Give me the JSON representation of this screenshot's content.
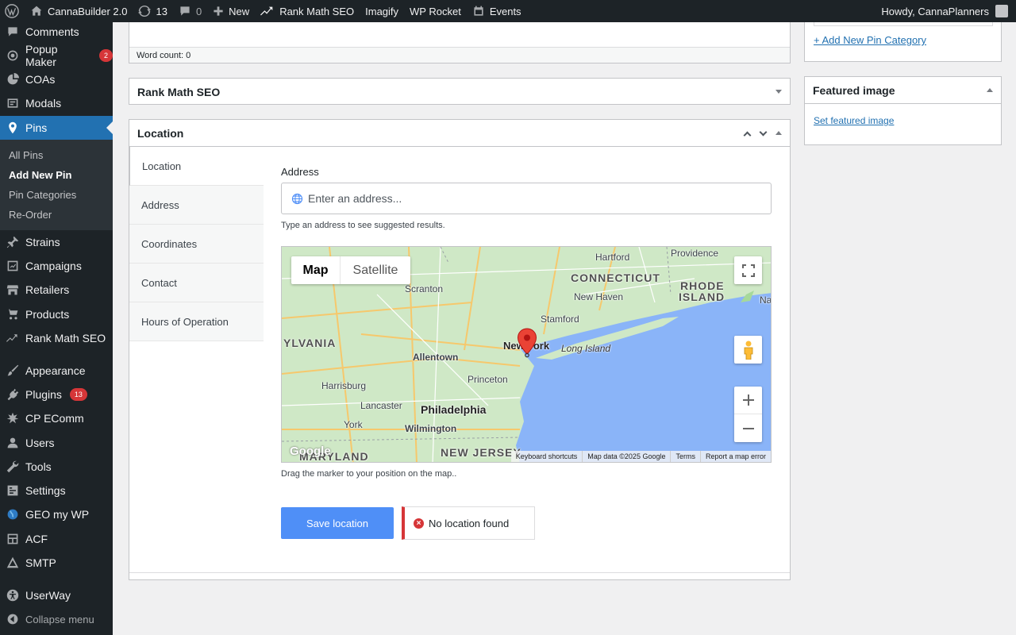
{
  "admin_bar": {
    "site_name": "CannaBuilder 2.0",
    "updates_count": "13",
    "comments_count": "0",
    "new_label": "New",
    "rank_math": "Rank Math SEO",
    "imagify": "Imagify",
    "wp_rocket": "WP Rocket",
    "events": "Events",
    "howdy": "Howdy, CannaPlanners"
  },
  "sidebar": {
    "items": [
      {
        "label": "Comments",
        "icon": "comment-icon"
      },
      {
        "label": "Popup Maker",
        "icon": "popup-icon",
        "badge": "2"
      },
      {
        "label": "COAs",
        "icon": "pie-icon"
      },
      {
        "label": "Modals",
        "icon": "modal-icon"
      },
      {
        "label": "Pins",
        "icon": "location-pin-icon"
      },
      {
        "label": "Strains",
        "icon": "pushpin-icon"
      },
      {
        "label": "Campaigns",
        "icon": "chart-icon"
      },
      {
        "label": "Retailers",
        "icon": "store-icon"
      },
      {
        "label": "Products",
        "icon": "cart-icon"
      },
      {
        "label": "Rank Math SEO",
        "icon": "rankmath-icon"
      },
      {
        "label": "Appearance",
        "icon": "brush-icon"
      },
      {
        "label": "Plugins",
        "icon": "plug-icon",
        "badge": "13"
      },
      {
        "label": "CP EComm",
        "icon": "ecomm-icon"
      },
      {
        "label": "Users",
        "icon": "user-icon"
      },
      {
        "label": "Tools",
        "icon": "wrench-icon"
      },
      {
        "label": "Settings",
        "icon": "settings-icon"
      },
      {
        "label": "GEO my WP",
        "icon": "globe-icon"
      },
      {
        "label": "ACF",
        "icon": "acf-icon"
      },
      {
        "label": "SMTP",
        "icon": "smtp-icon"
      },
      {
        "label": "UserWay",
        "icon": "accessibility-icon"
      },
      {
        "label": "Collapse menu",
        "icon": "collapse-icon"
      }
    ],
    "submenu": [
      "All Pins",
      "Add New Pin",
      "Pin Categories",
      "Re-Order"
    ],
    "current_submenu": "Add New Pin"
  },
  "editor": {
    "word_count": "Word count: 0"
  },
  "rank_math_box": {
    "title": "Rank Math SEO"
  },
  "location_box": {
    "title": "Location",
    "tabs": [
      "Location",
      "Address",
      "Coordinates",
      "Contact",
      "Hours of Operation"
    ],
    "active_tab": "Location",
    "address_label": "Address",
    "address_placeholder": "Enter an address...",
    "address_help": "Type an address to see suggested results.",
    "drag_help": "Drag the marker to your position on the map..",
    "save_button": "Save location",
    "notice": "No location found"
  },
  "map": {
    "type_buttons": [
      "Map",
      "Satellite"
    ],
    "active_type": "Map",
    "labels": {
      "hartford": "Hartford",
      "providence": "Providence",
      "connecticut": "CONNECTICUT",
      "rhode": "RHODE",
      "island": "ISLAND",
      "na": "Na",
      "scranton": "Scranton",
      "new_haven": "New Haven",
      "stamford": "Stamford",
      "ylvania": "YLVANIA",
      "new_york": "New York",
      "long_island": "Long Island",
      "allentown": "Allentown",
      "princeton": "Princeton",
      "harrisburg": "Harrisburg",
      "lancaster": "Lancaster",
      "philadelphia": "Philadelphia",
      "york": "York",
      "wilmington": "Wilmington",
      "maryland": "MARYLAND",
      "new_jersey": "NEW JERSEY",
      "google": "Google"
    },
    "footer": [
      "Keyboard shortcuts",
      "Map data ©2025 Google",
      "Terms",
      "Report a map error"
    ],
    "colors": {
      "land": "#c9e7c0",
      "water": "#8ab4f8",
      "roads": "#f6c86c",
      "marker": "#ea4335"
    }
  },
  "right_column": {
    "add_category_link": "+ Add New Pin Category",
    "featured_title": "Featured image",
    "set_featured_link": "Set featured image"
  }
}
